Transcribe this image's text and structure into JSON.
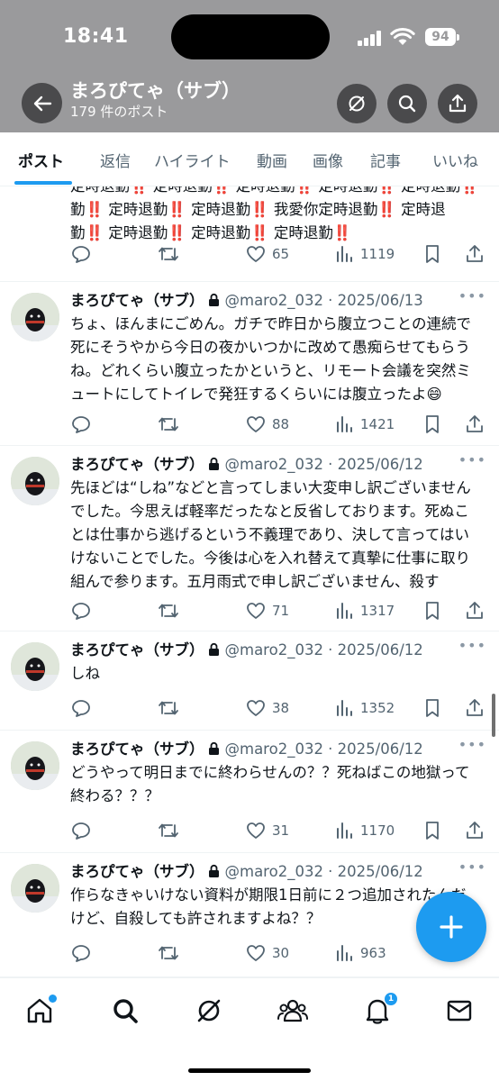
{
  "status_bar": {
    "time": "18:41",
    "battery": "94"
  },
  "header": {
    "title": "まろぴてゃ（サブ）",
    "subtitle": "179 件のポスト"
  },
  "tabs": [
    "ポスト",
    "返信",
    "ハイライト",
    "動画",
    "画像",
    "記事",
    "いいね"
  ],
  "first_post": {
    "text": "定時退勤‼️ 定時退勤‼️ 定時退勤‼️ 定時退勤‼️ 定時退勤‼️\n勤‼️ 定時退勤‼️ 定時退勤‼️ 我愛你定時退勤‼️ 定時退\n勤‼️ 定時退勤‼️ 定時退勤‼️ 定時退勤‼️",
    "likes": "65",
    "views": "1119"
  },
  "posts": [
    {
      "name": "まろぴてゃ（サブ）",
      "handle": "@maro2_032 · 2025/06/13",
      "text": "ちょ、ほんまにごめん。ガチで昨日から腹立つことの連続で\n死にそうやから今日の夜かいつかに改めて愚痴らせてもらう\nね。どれくらい腹立ったかというと、リモート会議を突然ミ\nュートにしてトイレで発狂するくらいには腹立ったよ😄",
      "likes": "88",
      "views": "1421"
    },
    {
      "name": "まろぴてゃ（サブ）",
      "handle": "@maro2_032 · 2025/06/12",
      "text": "先ほどは“しね”などと言ってしまい大変申し訳ございません\nでした。今思えば軽率だったなと反省しております。死ぬこ\nとは仕事から逃げるという不義理であり、決して言ってはい\nけないことでした。今後は心を入れ替えて真摯に仕事に取り\n組んで参ります。五月雨式で申し訳ございません、殺す",
      "likes": "71",
      "views": "1317"
    },
    {
      "name": "まろぴてゃ（サブ）",
      "handle": "@maro2_032 · 2025/06/12",
      "text": "しね",
      "likes": "38",
      "views": "1352"
    },
    {
      "name": "まろぴてゃ（サブ）",
      "handle": "@maro2_032 · 2025/06/12",
      "text": "どうやって明日までに終わらせんの？？死ねばこの地獄って\n終わる？？？",
      "likes": "31",
      "views": "1170"
    },
    {
      "name": "まろぴてゃ（サブ）",
      "handle": "@maro2_032 · 2025/06/12",
      "text": "作らなきゃいけない資料が期限1日前に２つ追加されたんだ\nけど、自殺しても許されますよね？？",
      "likes": "30",
      "views": "963"
    }
  ],
  "notifications_badge": "1",
  "colors": {
    "accent": "#1d9bf0",
    "header_bg": "#9a9a9c",
    "muted": "#536471"
  }
}
